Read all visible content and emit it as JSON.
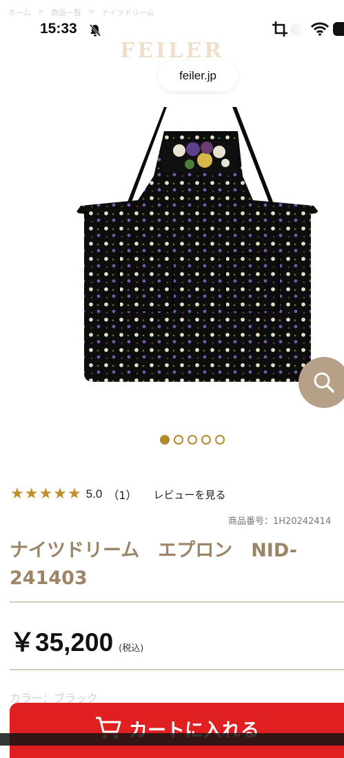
{
  "breadcrumb": [
    "ホーム",
    "商品一覧",
    "ナイツドリーム"
  ],
  "status_bar": {
    "time": "15:33"
  },
  "brand": {
    "logo_text": "FEILER"
  },
  "browser": {
    "url": "feiler.jp"
  },
  "gallery": {
    "total_images": 5,
    "active_index": 0
  },
  "rating": {
    "stars": [
      "★",
      "★",
      "★",
      "★",
      "★"
    ],
    "score": "5.0",
    "count": "（1）",
    "review_link": "レビューを見る"
  },
  "product": {
    "code": "商品番号：1H20242414",
    "title_line1": "ナイツドリーム　エプロン　NID-",
    "title_line2": "241403",
    "price": "￥35,200",
    "tax_note": "(税込)",
    "color_label": "カラー：ブラック"
  },
  "cart": {
    "label": "カートに入れる"
  },
  "colors": {
    "accent": "#b08a2c",
    "title": "#9b8566",
    "cart": "#e02020",
    "zoom": "#b6a188"
  }
}
